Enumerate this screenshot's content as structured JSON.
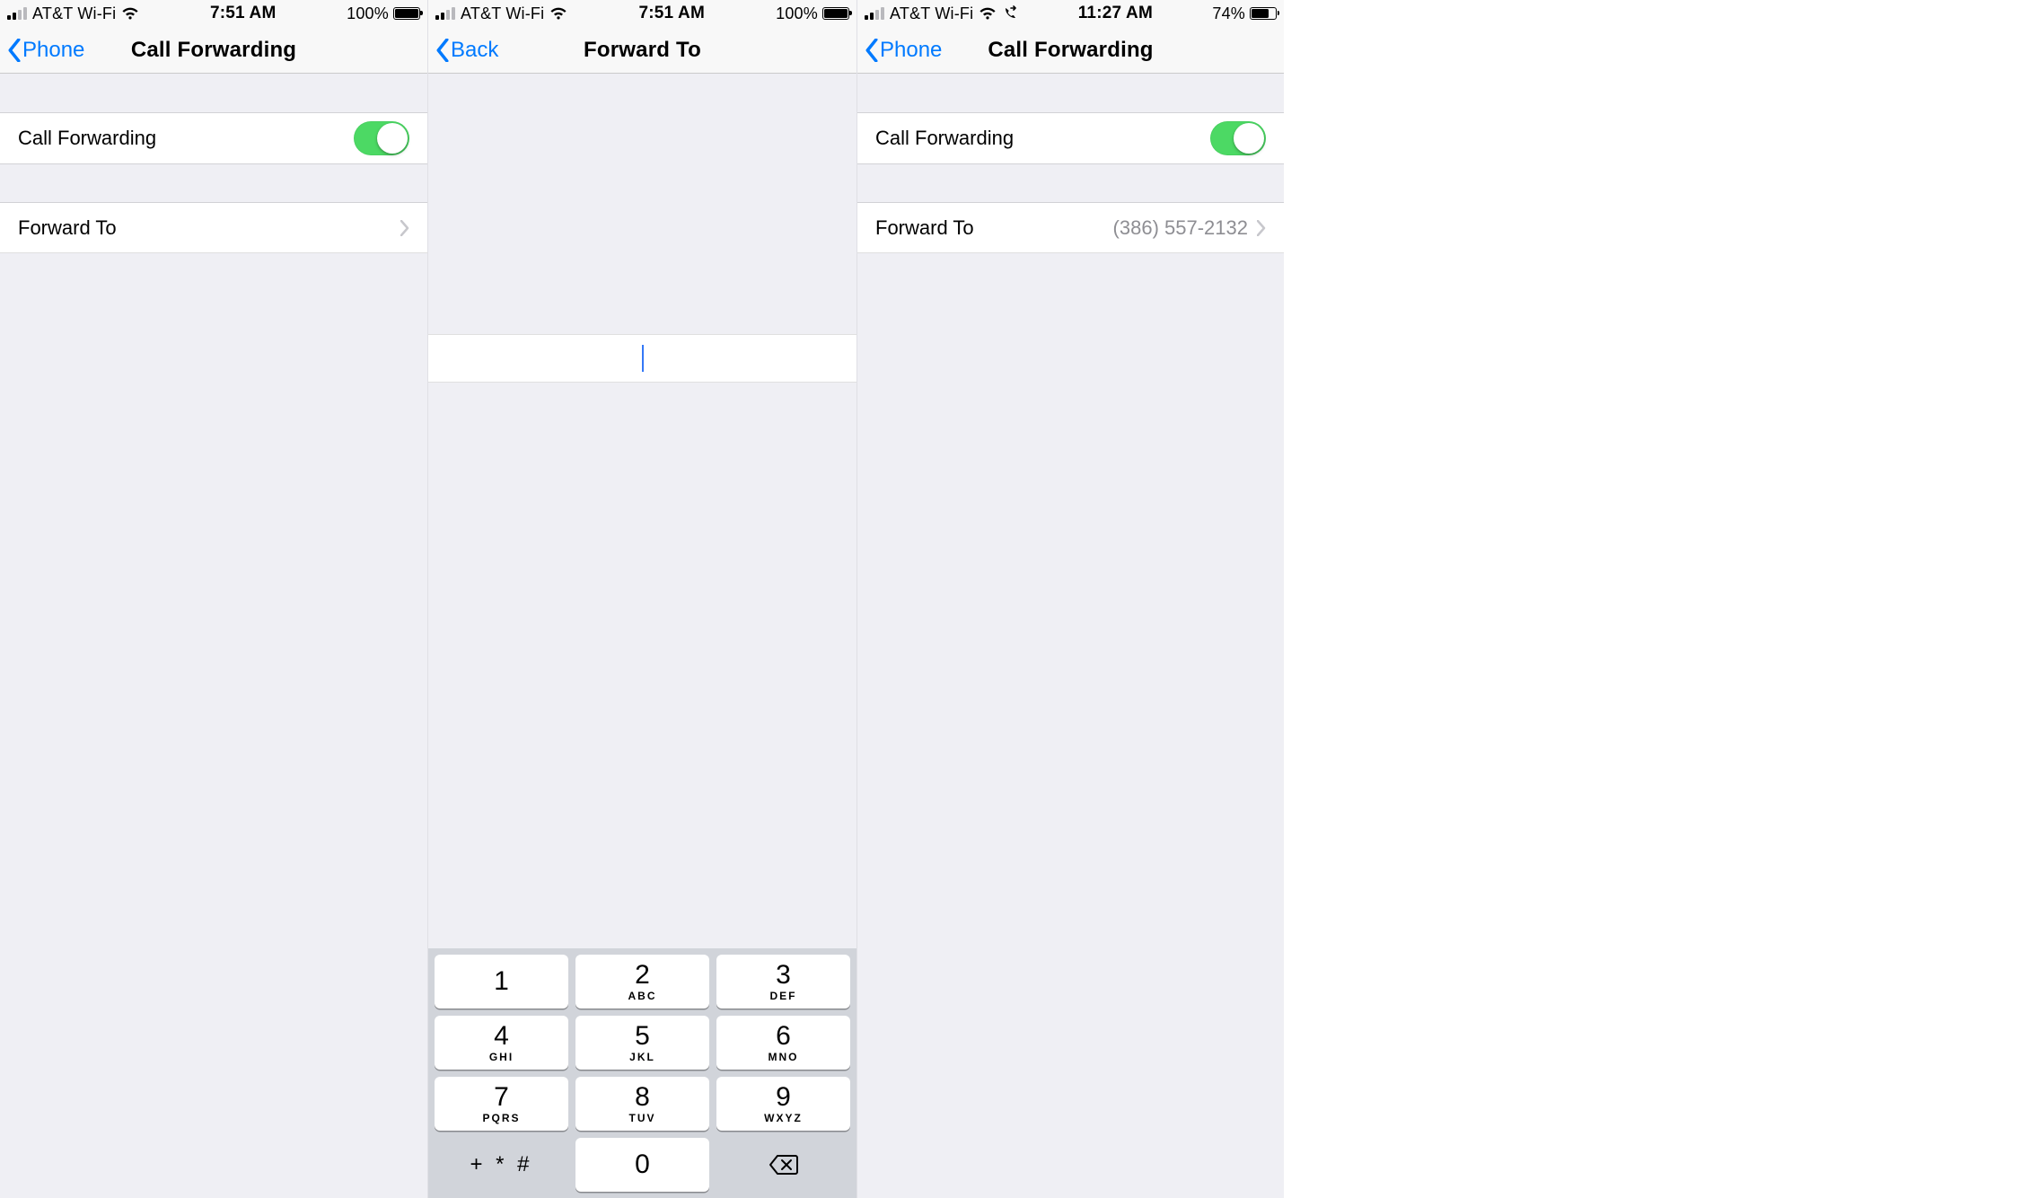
{
  "panes": [
    {
      "status": {
        "carrier": "AT&T Wi-Fi",
        "time": "7:51 AM",
        "battery_pct": "100%",
        "battery_fill": 100,
        "signal_bars_on": 2,
        "show_fwd_icon": false
      },
      "nav": {
        "back_label": "Phone",
        "title": "Call Forwarding"
      },
      "rows": {
        "toggle_label": "Call Forwarding",
        "toggle_on": true,
        "forward_label": "Forward To",
        "forward_value": ""
      }
    },
    {
      "status": {
        "carrier": "AT&T Wi-Fi",
        "time": "7:51 AM",
        "battery_pct": "100%",
        "battery_fill": 100,
        "signal_bars_on": 2,
        "show_fwd_icon": false
      },
      "nav": {
        "back_label": "Back",
        "title": "Forward To"
      },
      "input_value": "",
      "keypad": {
        "keys": [
          {
            "num": "1",
            "sub": ""
          },
          {
            "num": "2",
            "sub": "ABC"
          },
          {
            "num": "3",
            "sub": "DEF"
          },
          {
            "num": "4",
            "sub": "GHI"
          },
          {
            "num": "5",
            "sub": "JKL"
          },
          {
            "num": "6",
            "sub": "MNO"
          },
          {
            "num": "7",
            "sub": "PQRS"
          },
          {
            "num": "8",
            "sub": "TUV"
          },
          {
            "num": "9",
            "sub": "WXYZ"
          }
        ],
        "sym_key": "+ * #",
        "zero": "0"
      }
    },
    {
      "status": {
        "carrier": "AT&T Wi-Fi",
        "time": "11:27 AM",
        "battery_pct": "74%",
        "battery_fill": 74,
        "signal_bars_on": 2,
        "show_fwd_icon": true
      },
      "nav": {
        "back_label": "Phone",
        "title": "Call Forwarding"
      },
      "rows": {
        "toggle_label": "Call Forwarding",
        "toggle_on": true,
        "forward_label": "Forward To",
        "forward_value": "(386) 557-2132"
      }
    }
  ]
}
